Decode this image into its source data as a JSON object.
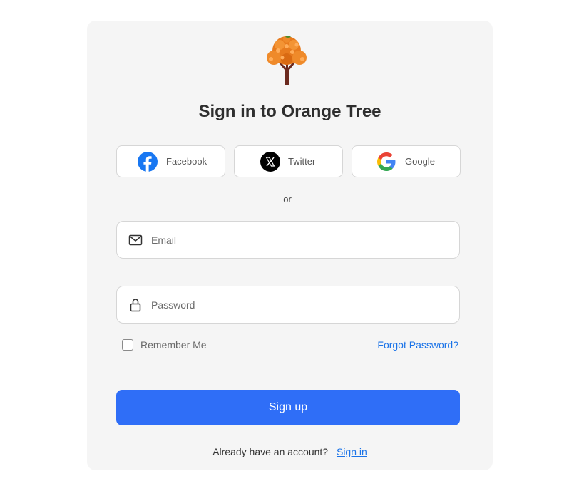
{
  "brand": {
    "title": "Sign in to Orange Tree",
    "accent": "#2f6ef7",
    "logo_icon": "orange-tree-icon"
  },
  "social": [
    {
      "label": "Facebook",
      "icon": "facebook-icon",
      "color": "#1877f2"
    },
    {
      "label": "Twitter",
      "icon": "x-twitter-icon",
      "color": "#000000"
    },
    {
      "label": "Google",
      "icon": "google-icon",
      "color": "#4285f4"
    }
  ],
  "divider": {
    "text": "or"
  },
  "form": {
    "email": {
      "placeholder": "Email",
      "value": "",
      "icon": "mail-icon"
    },
    "password": {
      "placeholder": "Password",
      "value": "",
      "icon": "lock-icon"
    },
    "remember_label": "Remember Me",
    "remember_checked": false,
    "forgot_label": "Forgot Password?",
    "submit_label": "Sign up"
  },
  "footer": {
    "prompt": "Already have an account?",
    "link_label": "Sign in"
  }
}
